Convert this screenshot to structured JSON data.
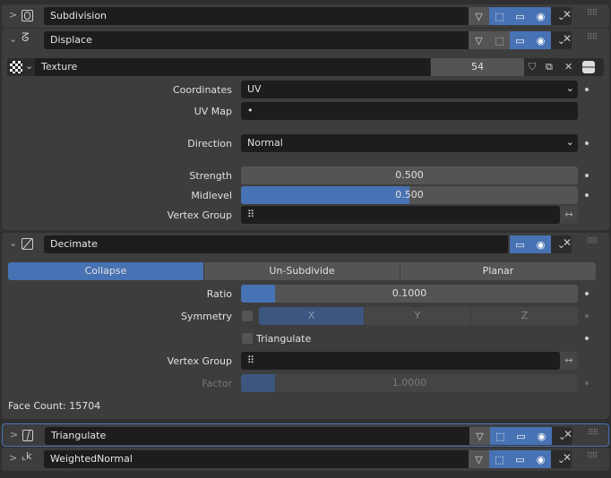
{
  "modifiers": {
    "subdivision": {
      "name": "Subdivision",
      "expanded": false
    },
    "displace": {
      "name": "Displace",
      "expanded": true,
      "texture": {
        "label": "Texture",
        "users": "54"
      },
      "coordinates": {
        "label": "Coordinates",
        "value": "UV"
      },
      "uv_map": {
        "label": "UV Map",
        "value": "•"
      },
      "direction": {
        "label": "Direction",
        "value": "Normal"
      },
      "strength": {
        "label": "Strength",
        "value": "0.500",
        "fill": 0
      },
      "midlevel": {
        "label": "Midlevel",
        "value": "0.500",
        "fill": 0.5
      },
      "vertex_group": {
        "label": "Vertex Group",
        "value": ""
      }
    },
    "decimate": {
      "name": "Decimate",
      "expanded": true,
      "modes": [
        "Collapse",
        "Un-Subdivide",
        "Planar"
      ],
      "active_mode": "Collapse",
      "ratio": {
        "label": "Ratio",
        "value": "0.1000",
        "fill": 0.1
      },
      "symmetry": {
        "label": "Symmetry",
        "axes": [
          "X",
          "Y",
          "Z"
        ],
        "active_axis": "X",
        "checked": false
      },
      "triangulate": {
        "label": "Triangulate",
        "checked": false
      },
      "vertex_group": {
        "label": "Vertex Group",
        "value": ""
      },
      "factor": {
        "label": "Factor",
        "value": "1.0000",
        "fill": 0.1,
        "disabled": true
      },
      "face_count": "Face Count: 15704"
    },
    "triangulate": {
      "name": "Triangulate",
      "expanded": false,
      "selected": true
    },
    "weighted_normal": {
      "name": "WeightedNormal",
      "expanded": false
    }
  },
  "colors": {
    "accent": "#4772b3",
    "panel": "#3d3d3d",
    "field": "#1d1d1d"
  }
}
